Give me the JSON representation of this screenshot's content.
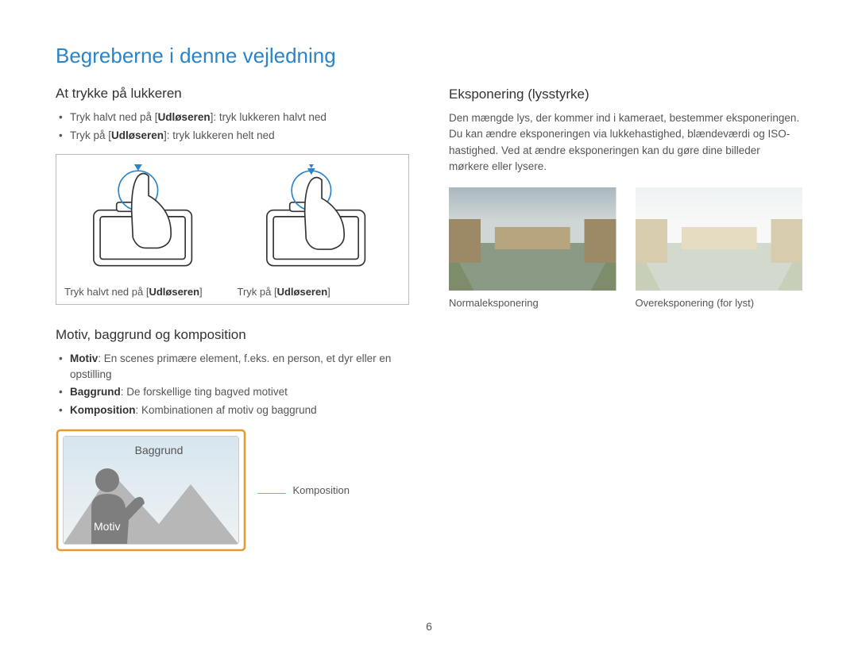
{
  "page_title": "Begreberne i denne vejledning",
  "page_number": "6",
  "left": {
    "shutter": {
      "title": "At trykke på lukkeren",
      "bullets": [
        {
          "pre": "Tryk halvt ned på [",
          "bold": "Udløseren",
          "post": "]: tryk lukkeren halvt ned"
        },
        {
          "pre": "Tryk på [",
          "bold": "Udløseren",
          "post": "]: tryk lukkeren helt ned"
        }
      ],
      "caption_left_pre": "Tryk halvt ned på [",
      "caption_left_bold": "Udløseren",
      "caption_left_post": "]",
      "caption_right_pre": "Tryk på [",
      "caption_right_bold": "Udløseren",
      "caption_right_post": "]"
    },
    "composition": {
      "title": "Motiv, baggrund og komposition",
      "bullets": [
        {
          "bold": "Motiv",
          "post": ": En scenes primære element, f.eks. en person, et dyr eller en opstilling"
        },
        {
          "bold": "Baggrund",
          "post": ": De forskellige ting bagved motivet"
        },
        {
          "bold": "Komposition",
          "post": ": Kombinationen af motiv og baggrund"
        }
      ],
      "label_baggrund": "Baggrund",
      "label_motiv": "Motiv",
      "label_komposition": "Komposition"
    }
  },
  "right": {
    "exposure": {
      "title": "Eksponering (lysstyrke)",
      "paragraph": "Den mængde lys, der kommer ind i kameraet, bestemmer eksponeringen. Du kan ændre eksponeringen via lukkehastighed, blændeværdi og ISO-hastighed. Ved at ændre eksponeringen kan du gøre dine billeder mørkere eller lysere.",
      "caption_normal": "Normaleksponering",
      "caption_over": "Overeksponering (for lyst)"
    }
  }
}
